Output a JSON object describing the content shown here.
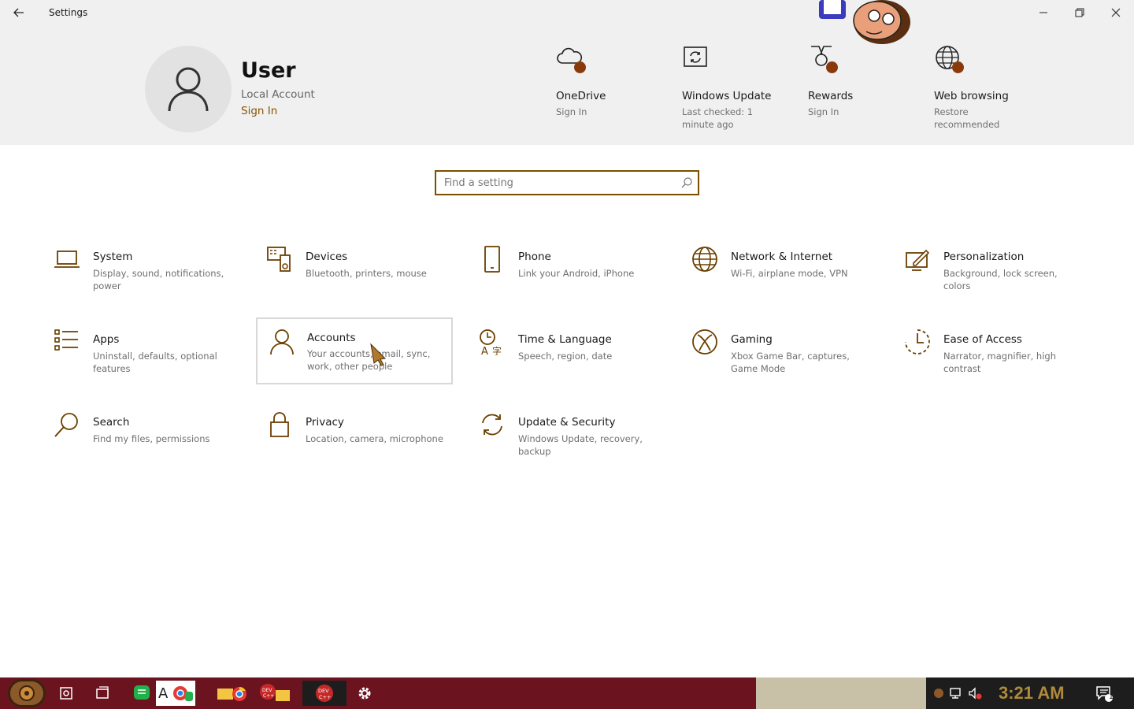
{
  "window": {
    "title": "Settings"
  },
  "profile": {
    "name": "User",
    "account_type": "Local Account",
    "sign_in": "Sign In"
  },
  "services": [
    {
      "title": "OneDrive",
      "subtitle": "Sign In",
      "icon": "cloud-icon"
    },
    {
      "title": "Windows Update",
      "subtitle": "Last checked: 1 minute ago",
      "icon": "update-icon"
    },
    {
      "title": "Rewards",
      "subtitle": "Sign In",
      "icon": "medal-icon"
    },
    {
      "title": "Web browsing",
      "subtitle": "Restore recommended",
      "icon": "globe-icon"
    }
  ],
  "search": {
    "placeholder": "Find a setting"
  },
  "categories": [
    {
      "title": "System",
      "desc": "Display, sound, notifications, power",
      "icon": "laptop-icon"
    },
    {
      "title": "Devices",
      "desc": "Bluetooth, printers, mouse",
      "icon": "devices-icon"
    },
    {
      "title": "Phone",
      "desc": "Link your Android, iPhone",
      "icon": "phone-icon"
    },
    {
      "title": "Network & Internet",
      "desc": "Wi-Fi, airplane mode, VPN",
      "icon": "globe-icon"
    },
    {
      "title": "Personalization",
      "desc": "Background, lock screen, colors",
      "icon": "brush-icon"
    },
    {
      "title": "Apps",
      "desc": "Uninstall, defaults, optional features",
      "icon": "apps-list-icon"
    },
    {
      "title": "Accounts",
      "desc": "Your accounts, email, sync, work, other people",
      "icon": "person-icon"
    },
    {
      "title": "Time & Language",
      "desc": "Speech, region, date",
      "icon": "time-language-icon"
    },
    {
      "title": "Gaming",
      "desc": "Xbox Game Bar, captures, Game Mode",
      "icon": "xbox-icon"
    },
    {
      "title": "Ease of Access",
      "desc": "Narrator, magnifier, high contrast",
      "icon": "ease-of-access-icon"
    },
    {
      "title": "Search",
      "desc": "Find my files, permissions",
      "icon": "search-icon"
    },
    {
      "title": "Privacy",
      "desc": "Location, camera, microphone",
      "icon": "lock-icon"
    },
    {
      "title": "Update & Security",
      "desc": "Windows Update, recovery, backup",
      "icon": "sync-icon"
    }
  ],
  "taskbar": {
    "time": "3:21 AM",
    "notification_count": "1",
    "colors": {
      "accent": "#7a4f00",
      "taskbar": "#6b1420"
    }
  }
}
